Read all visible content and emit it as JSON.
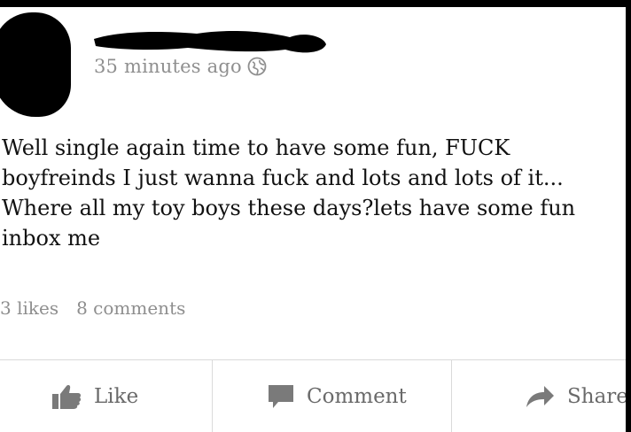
{
  "post": {
    "timestamp": "35 minutes ago",
    "privacy_icon": "globe-icon",
    "text": "Well single again time to have some fun, FUCK boyfreinds I just wanna fuck and lots and lots of it... Where all my toy boys these days?lets have some fun inbox me",
    "likes": "3 likes",
    "comments": "8 comments"
  },
  "actions": {
    "like_label": "Like",
    "comment_label": "Comment",
    "share_label": "Share"
  },
  "icons": {
    "like": "thumbs-up-icon",
    "comment": "speech-bubble-icon",
    "share": "share-arrow-icon"
  },
  "colors": {
    "icon_gray": "#7a7a7a",
    "text_gray": "#8e8e8e",
    "redaction": "#000000"
  }
}
